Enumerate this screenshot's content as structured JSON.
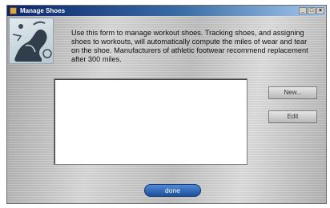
{
  "window": {
    "title": "Manage Shoes",
    "controls": {
      "minimize": "_",
      "maximize": "□",
      "close": "×"
    }
  },
  "intro": {
    "text": "Use this form to manage workout shoes.  Tracking shoes, and assigning shoes to workouts, will automatically compute the miles of wear and tear on the shoe.  Manufacturers of athletic footwear recommend replacement after 300 miles."
  },
  "buttons": {
    "new": "New...",
    "edit": "Edit",
    "done": "done"
  },
  "shoes_list": {
    "items": []
  },
  "icons": {
    "window": "shoe-app-icon",
    "picture": "shoe-illustration"
  }
}
